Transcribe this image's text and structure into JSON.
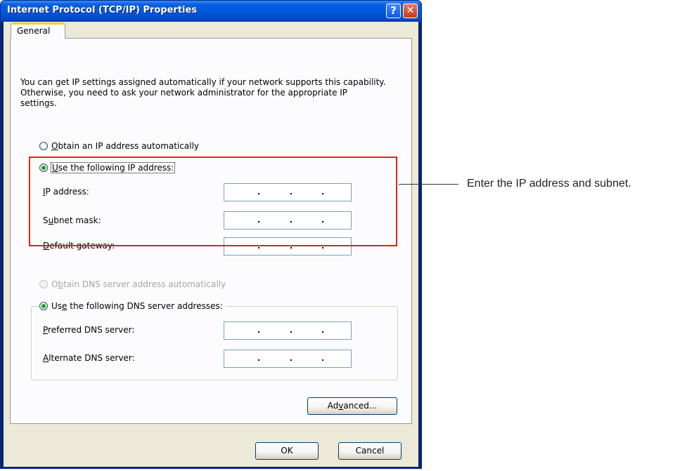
{
  "window": {
    "title": "Internet Protocol (TCP/IP) Properties",
    "help_icon": "help-question-icon",
    "close_icon": "close-x-icon",
    "help_glyph": "?",
    "close_glyph": "✕"
  },
  "tabs": [
    {
      "label": "General",
      "active": true
    }
  ],
  "description": "You can get IP settings assigned automatically if your network supports this capability. Otherwise, you need to ask your network administrator for the appropriate IP settings.",
  "ip_section": {
    "auto_option": {
      "accel": "O",
      "rest": "btain an IP address automatically",
      "checked": false
    },
    "manual_option": {
      "accel": "U",
      "rest": "se the following IP address:",
      "checked": true
    },
    "fields": [
      {
        "accel": "I",
        "rest": "P address:",
        "value": ""
      },
      {
        "pre": "S",
        "accel": "u",
        "rest": "bnet mask:",
        "value": ""
      },
      {
        "accel": "D",
        "rest": "efault gateway:",
        "value": ""
      }
    ]
  },
  "dns_section": {
    "auto_option": {
      "pre": "O",
      "accel": "b",
      "rest": "tain DNS server address automatically",
      "checked": false,
      "disabled": true
    },
    "manual_option": {
      "pre": "Us",
      "accel": "e",
      "rest": " the following DNS server addresses:",
      "checked": true
    },
    "fields": [
      {
        "accel": "P",
        "rest": "referred DNS server:",
        "value": ""
      },
      {
        "accel": "A",
        "rest": "lternate DNS server:",
        "value": ""
      }
    ]
  },
  "buttons": {
    "advanced": {
      "pre": "Ad",
      "accel": "v",
      "rest": "anced..."
    },
    "ok": "OK",
    "cancel": "Cancel"
  },
  "annotation": {
    "text": "Enter the IP address and subnet.",
    "highlight_color": "#e2231a"
  }
}
